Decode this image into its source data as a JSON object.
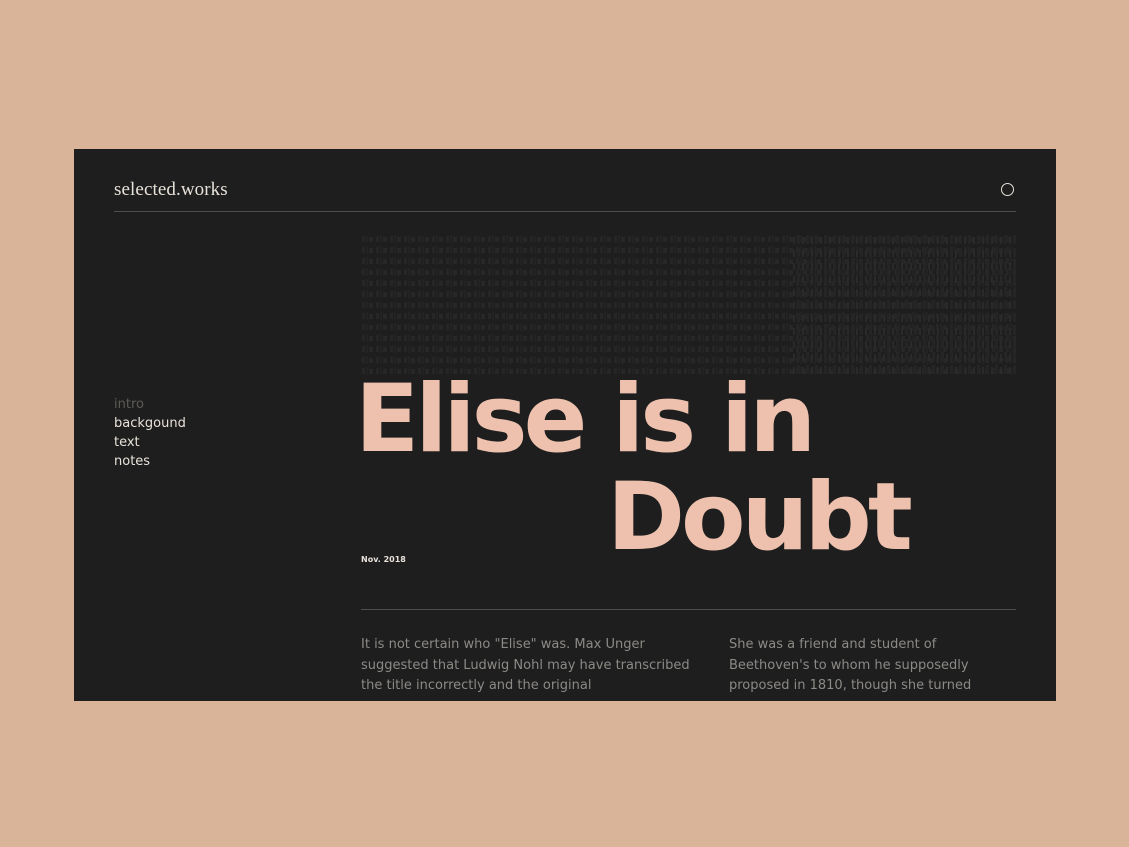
{
  "site": {
    "logo": "selected.works"
  },
  "nav": {
    "items": [
      {
        "label": "intro",
        "active": true
      },
      {
        "label": "backgound",
        "active": false
      },
      {
        "label": "text",
        "active": false
      },
      {
        "label": "notes",
        "active": false
      }
    ]
  },
  "article": {
    "title_line1": "Elise is in",
    "title_line2": "Doubt",
    "date": "Nov. 2018",
    "column_left": "It is not certain who \"Elise\" was. Max Unger suggested that Ludwig Nohl may have transcribed the title incorrectly and the original",
    "column_right": "She was a friend and student of Beethoven's to whom he supposedly proposed in 1810, though she turned"
  },
  "colors": {
    "page_background": "#D9B498",
    "panel_background": "#1E1E1E",
    "accent": "#EDC1AE",
    "text_light": "#E8E2DA",
    "text_muted": "#8C8A86"
  },
  "icons": {
    "menu": "circle-menu-icon"
  }
}
